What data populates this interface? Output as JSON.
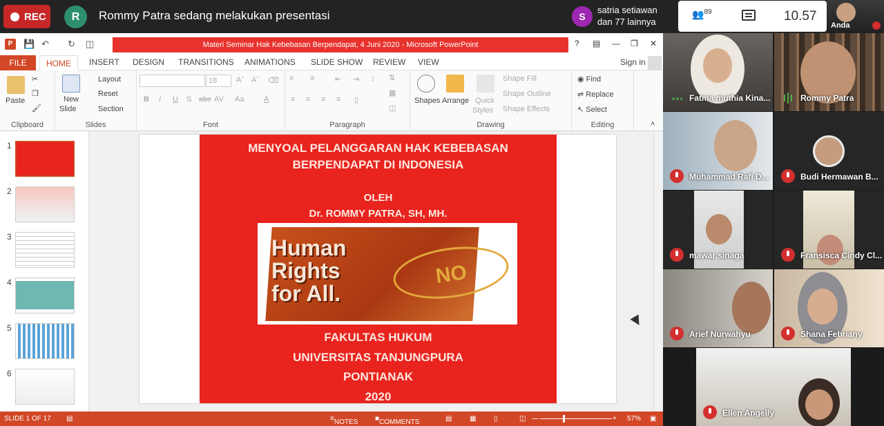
{
  "meeting": {
    "rec_label": "REC",
    "presenter_initial": "R",
    "presenting_text": "Rommy Patra sedang melakukan presentasi",
    "viewer_initial": "S",
    "viewers_line1": "satria setiawan",
    "viewers_line2": "dan 77 lainnya",
    "participant_count": "89",
    "clock": "10.57",
    "self_label": "Anda"
  },
  "ppt": {
    "window_title": "Materi Seminar Hak Kebebasan Berpendapat, 4 Juni 2020 -  Microsoft PowerPoint",
    "tabs": [
      "FILE",
      "HOME",
      "INSERT",
      "DESIGN",
      "TRANSITIONS",
      "ANIMATIONS",
      "SLIDE SHOW",
      "REVIEW",
      "VIEW"
    ],
    "sign_in": "Sign in",
    "ribbon": {
      "clipboard": {
        "label": "Clipboard",
        "paste": "Paste"
      },
      "slides": {
        "label": "Slides",
        "new": "New",
        "slide": "Slide",
        "layout": "Layout",
        "reset": "Reset",
        "section": "Section"
      },
      "font": {
        "label": "Font",
        "size": "18",
        "bold": "B",
        "italic": "I",
        "underline": "U",
        "strike": "S",
        "abc": "abc",
        "av": "AV",
        "aa": "Aa",
        "a": "A"
      },
      "paragraph": {
        "label": "Paragraph"
      },
      "drawing": {
        "label": "Drawing",
        "shapes": "Shapes",
        "arrange": "Arrange",
        "quick": "Quick",
        "styles": "Styles",
        "fill": "Shape Fill",
        "outline": "Shape Outline",
        "effects": "Shape Effects"
      },
      "editing": {
        "label": "Editing",
        "find": "Find",
        "replace": "Replace",
        "select": "Select"
      }
    },
    "thumb_numbers": [
      "1",
      "2",
      "3",
      "4",
      "5",
      "6"
    ],
    "slide": {
      "title_line1": "MENYOAL PELANGGARAN HAK KEBEBASAN",
      "title_line2": "BERPENDAPAT DI INDONESIA",
      "oleh": "OLEH",
      "author": "Dr. ROMMY PATRA, SH, MH.",
      "banner_text1": "Human",
      "banner_text2": "Rights",
      "banner_text3": "for All.",
      "banner_badge": "NO",
      "faculty": "FAKULTAS HUKUM",
      "university": "UNIVERSITAS TANJUNGPURA",
      "city": "PONTIANAK",
      "year": "2020"
    },
    "status": {
      "slide_counter": "SLIDE 1 OF 17",
      "notes": "NOTES",
      "comments": "COMMENTS",
      "zoom": "57%"
    }
  },
  "participants": [
    {
      "name": "Fatma muthia Kina...",
      "status": "active"
    },
    {
      "name": "Rommy Patra",
      "status": "speaking"
    },
    {
      "name": "Muhammad Rafi D...",
      "status": "muted"
    },
    {
      "name": "Budi Hermawan B...",
      "status": "muted"
    },
    {
      "name": "mawar sinaga",
      "status": "muted"
    },
    {
      "name": "Fransisca Cindy Cl...",
      "status": "muted"
    },
    {
      "name": "Arief Nurwahyu",
      "status": "muted"
    },
    {
      "name": "Shana Febriany",
      "status": "muted"
    },
    {
      "name": "Ellen Angelly",
      "status": "muted"
    }
  ]
}
